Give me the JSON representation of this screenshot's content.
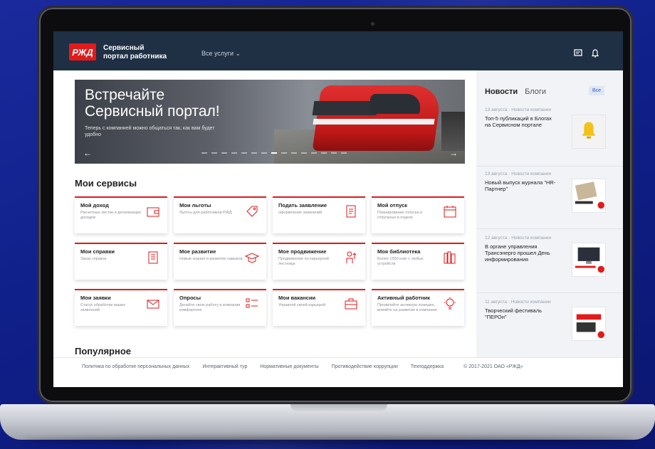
{
  "header": {
    "brand_logo": "РЖД",
    "brand_line1": "Сервисный",
    "brand_line2": "портал работника",
    "all_services": "Все услуги ⌄"
  },
  "banner": {
    "title_line1": "Встречайте",
    "title_line2": "Сервисный портал!",
    "subtitle": "Теперь с компанией можно общаться так, как вам будет удобно"
  },
  "sections": {
    "my_services": "Мои сервисы",
    "popular": "Популярное"
  },
  "services": [
    {
      "title": "Мой доход",
      "desc": "Расчетные листки и детализация доходов"
    },
    {
      "title": "Мои льготы",
      "desc": "Льготы для работников РЖД"
    },
    {
      "title": "Подать заявление",
      "desc": "оформление заявлений"
    },
    {
      "title": "Мой отпуск",
      "desc": "Планирование отпуска и отпускные в отделе"
    },
    {
      "title": "Мои справки",
      "desc": "Заказ справок"
    },
    {
      "title": "Мое развитие",
      "desc": "Новые знания и развитие навыков"
    },
    {
      "title": "Мое продвижение",
      "desc": "Продвижение по карьерной лестнице"
    },
    {
      "title": "Моя библиотека",
      "desc": "Более 1500 книг с любых устройств"
    },
    {
      "title": "Мои заявки",
      "desc": "Статус обработки ваших заявлений"
    },
    {
      "title": "Опросы",
      "desc": "Делайте свою работу в компании комфортнее"
    },
    {
      "title": "Мои вакансии",
      "desc": "Управляй своей карьерой"
    },
    {
      "title": "Активный работник",
      "desc": "Проявляйте активную позицию, влияйте на развитие в компании"
    }
  ],
  "footer": {
    "links": [
      "Политика по обработке персональных данных",
      "Интерактивный тур",
      "Нормативные документы",
      "Противодействие коррупции",
      "Техподдержка"
    ],
    "copyright": "© 2017-2021 ОАО «РЖД»"
  },
  "sidebar": {
    "tab_news": "Новости",
    "tab_blogs": "Блоги",
    "all_button": "Все",
    "news": [
      {
        "meta": "13 августа · Новости компании",
        "title": "Топ-5 публикаций в Блогах на Сервисном портале"
      },
      {
        "meta": "13 августа · Новости компании",
        "title": "Новый выпуск журнала \"HR-Партнер\""
      },
      {
        "meta": "12 августа · Новости компании",
        "title": "В органе управления Трансэнерго прошел День информирования"
      },
      {
        "meta": "11 августа · Новости компании",
        "title": "Творческий фестиваль \"ПЕРОн\""
      }
    ]
  },
  "colors": {
    "accent": "#e21a1a",
    "header_bg": "#1f2f44",
    "sidebar_bg": "#f1f3f6"
  }
}
